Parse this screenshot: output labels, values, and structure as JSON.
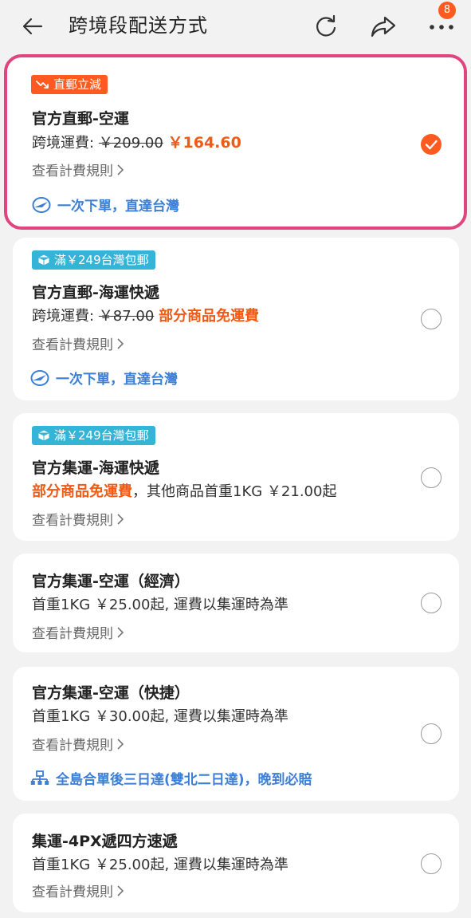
{
  "header": {
    "title": "跨境段配送方式",
    "back_icon": "arrow-left-icon",
    "refresh_icon": "refresh-icon",
    "share_icon": "share-icon",
    "more_icon": "more-dots-icon",
    "badge_count": "8"
  },
  "colors": {
    "accent": "#ff5a1f",
    "selected_border": "#e0457f",
    "link": "#3d7fd6",
    "promo_blue": "#34b4d6"
  },
  "options": [
    {
      "promo": "直郵立減",
      "name": "官方直郵-空運",
      "fee_label": "跨境運費: ",
      "fee_original": "￥209.00",
      "fee_highlight": "￥164.60",
      "rule": "查看計費規則",
      "feature": "一次下單，直達台灣",
      "selected": true
    },
    {
      "promo": "滿￥249台灣包郵",
      "name": "官方直郵-海運快遞",
      "fee_label": "跨境運費: ",
      "fee_original": "￥87.00",
      "fee_highlight": "部分商品免運費",
      "rule": "查看計費規則",
      "feature": "一次下單，直達台灣",
      "selected": false
    },
    {
      "promo": "滿￥249台灣包郵",
      "name": "官方集運-海運快遞",
      "fee_highlight": "部分商品免運費",
      "fee_rest": "，其他商品首重1KG ￥21.00起",
      "rule": "查看計費規則",
      "selected": false
    },
    {
      "name": "官方集運-空運（經濟）",
      "desc": "首重1KG ￥25.00起, 運費以集運時為準",
      "rule": "查看計費規則",
      "selected": false
    },
    {
      "name": "官方集運-空運（快捷）",
      "desc": "首重1KG ￥30.00起, 運費以集運時為準",
      "rule": "查看計費規則",
      "feature": "全島合單後三日達(雙北二日達)，晚到必賠",
      "selected": false
    },
    {
      "name": "集運-4PX遞四方速遞",
      "desc": "首重1KG ￥25.00起, 運費以集運時為準",
      "rule": "查看計費規則",
      "selected": false
    }
  ]
}
